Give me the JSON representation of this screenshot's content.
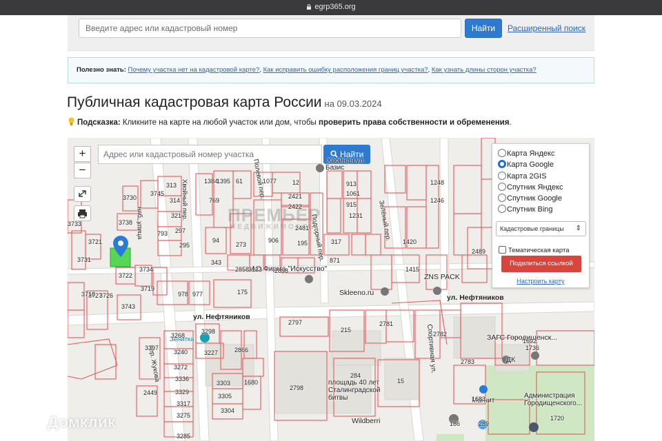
{
  "browser": {
    "url": "egrp365.org"
  },
  "search": {
    "placeholder": "Введите адрес или кадастровый номер",
    "button_label": "Найти",
    "advanced_link": "Расширенный поиск"
  },
  "info": {
    "prefix": "Полезно знать:",
    "links": [
      "Почему участка нет на кадастровой карте?",
      "Как исправить ошибку расположения границ участка?",
      "Как узнать длины сторон участка?"
    ]
  },
  "page": {
    "title": "Публичная кадастровая карта России",
    "date": "на 09.03.2024"
  },
  "hint": {
    "label": "Подсказка:",
    "text": "Кликните на карте на любой участок или дом, чтобы",
    "emphasis": "проверить права собственности и обременения",
    "end": "."
  },
  "map": {
    "search_placeholder": "Адрес или кадастровый номер участка",
    "search_button": "Найти",
    "zoom_in": "+",
    "zoom_out": "−",
    "layers": {
      "options": [
        "Карта Яндекс",
        "Карта Google",
        "Карта 2GIS",
        "Спутник Яндекс",
        "Спутник Google",
        "Спутник Bing"
      ],
      "selected": "Карта Google",
      "select_value": "Кадастровые границы",
      "thematic_label": "Тематическая карта",
      "share_button": "Поделиться ссылкой",
      "configure_link": "Настроить карту"
    },
    "watermark": "ПРЕМЬЕР",
    "watermark_sub": "НЕДВИЖИМОСТЬ",
    "streets": {
      "neftyanikov_1": "ул. Нефтяников",
      "neftyanikov_2": "ул. Нефтяников",
      "khvoyny": "Хвойный пер.",
      "khvoynaya": "Хвойная ул",
      "podgorny": "Подгорный пер.",
      "zelyony": "Зелёный пер.",
      "sportivnaya": "Спортивная ул.",
      "polevaya": "Полевой пер.",
      "zhukova": "пер. Жукова",
      "naberezhnaya": "наб. улица"
    },
    "places": {
      "bazis": "Базис",
      "ao_firma": "АО Фирма \"Искусство\"",
      "skleeno": "Skleeno.ru",
      "zns": "ZNS PACK",
      "zags": "ЗАГС Городищенск...",
      "dk": "ДК",
      "zenitka": "Зенитка",
      "ploshchad": "площадь 40 лет Сталинградской битвы",
      "wildberries": "Wildberri",
      "magnit": "Магнит",
      "admin": "Администрация Городищенского..."
    },
    "parcels": [
      "313",
      "314",
      "321",
      "297",
      "295",
      "3745",
      "3730",
      "3738",
      "793",
      "1384",
      "1395",
      "61",
      "1077",
      "12",
      "769",
      "2421",
      "2422",
      "2481",
      "94",
      "273",
      "906",
      "195",
      "317",
      "871",
      "343",
      "2858",
      "3123",
      "1231",
      "1061",
      "913",
      "915",
      "2898",
      "3722",
      "3734",
      "3719",
      "978",
      "977",
      "175",
      "3727",
      "3726",
      "3743",
      "3731",
      "3721",
      "3733",
      "3718",
      "3268",
      "3240",
      "3272",
      "3336",
      "3329",
      "3317",
      "3275",
      "3285",
      "3298",
      "3227",
      "2866",
      "3303",
      "3305",
      "3304",
      "1680",
      "2797",
      "215",
      "2781",
      "2782",
      "2783",
      "2798",
      "284",
      "15",
      "2449",
      "1248",
      "1246",
      "1420",
      "1415",
      "2489",
      "1683",
      "1720",
      "1692",
      "1736",
      "3397",
      "186",
      "289"
    ],
    "brand": "Домклик"
  }
}
